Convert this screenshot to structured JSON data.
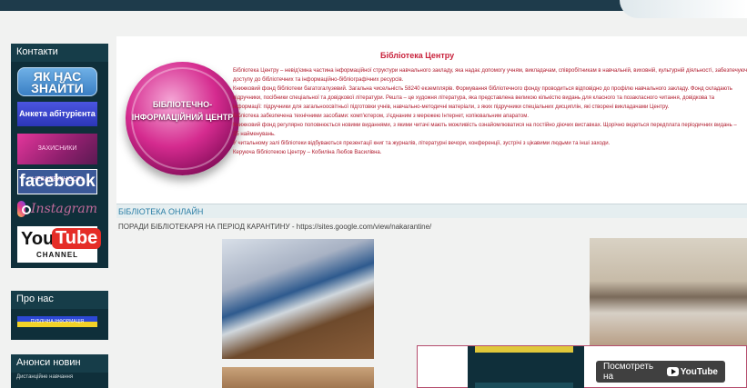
{
  "sidebar": {
    "contacts_heading": "Контакти",
    "find_us": "ЯК НАС ЗНАЙТИ",
    "anketa": "Анкета абітурієнта",
    "pink_banner": "ЗАХИСНИКИ НЕЗАЛЕЖНОСТІ",
    "facebook": "facebook",
    "instagram": "Instagram",
    "youtube_you": "You",
    "youtube_tube": "Tube",
    "youtube_channel": "CHANNEL",
    "about_heading": "Про нас",
    "public_info": "ПУБЛІЧНА ІНФОРМАЦІЯ",
    "news_heading": "Анонси новин",
    "news_item": "Дистанційне навчання"
  },
  "banner": {
    "logo_text": "БІБЛІОТЕЧНО-ІНФОРМАЦІЙНИЙ ЦЕНТР",
    "title": "Бібліотека Центру",
    "lines": [
      "Бібліотека Центру – невід'ємна частина інформаційної структури навчального закладу, яка надає допомогу учням, викладачам, співробітникам в навчальній, виховній, культурній діяльності, забезпечуючи",
      "доступу до бібліотечних та інформаційно-бібліографічних ресурсів.",
      "Книжковий фонд бібліотеки багатогалузевий. Загальна чисельність 58240 екземплярів. Формування бібліотечного фонду проводиться відповідно до профілю навчального закладу. Фонд складають",
      "підручники, посібники спеціальної та довідкової літератури. Решта – це художня література, яка представлена великою кількістю видань для класного та позакласного читання, довідкова та",
      "інформації: підручники для загальноосвітньої підготовки учнів, навчально-методичні матеріали, з яких підручники спеціальних дисциплін, які створені викладачами Центру.",
      "Бібліотека забезпечена технічними засобами: комп'ютером, з'єднаним з мережею Інтернет, копіювальним апаратом.",
      "Книжковий фонд регулярно поповнюється новими виданнями, з якими читачі мають можливість ознайомлюватися на постійно діючих виставках. Щорічно ведеться передплата періодичних видань –",
      " 25 найменувань.",
      "У читальному залі бібліотеки відбуваються презентації книг та журналів, літературні вечори, конференції, зустрічі з цікавими людьми та інші заходи.",
      "Керуюча бібліотекою Центру – Кобиліна Любов Василівна."
    ]
  },
  "lib_online": "БІБЛІОТЕКА ОНЛАЙН",
  "tips": "ПОРАДИ БІБЛІОТЕКАРЯ НА ПЕРІОД КАРАНТИНУ - https://sites.google.com/view/nakarantine/",
  "video": {
    "watch_on": "Посмотреть на",
    "youtube": "YouTube"
  }
}
